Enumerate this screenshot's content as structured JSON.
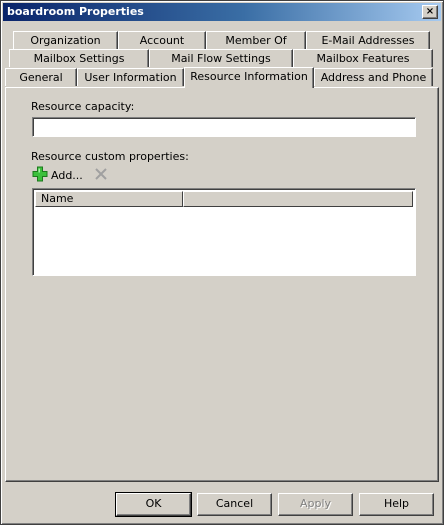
{
  "window": {
    "title": "boardroom Properties",
    "close_glyph": "×"
  },
  "tabs": {
    "row1": [
      "Organization",
      "Account",
      "Member Of",
      "E-Mail Addresses"
    ],
    "row2": [
      "Mailbox Settings",
      "Mail Flow Settings",
      "Mailbox Features"
    ],
    "row3": [
      "General",
      "User Information",
      "Resource Information",
      "Address and Phone"
    ],
    "active": "Resource Information"
  },
  "resource_tab": {
    "capacity_label": "Resource capacity:",
    "capacity_value": "",
    "custom_props_label": "Resource custom properties:",
    "add_label": "Add...",
    "list_columns": [
      "Name",
      ""
    ]
  },
  "buttons": {
    "ok": "OK",
    "cancel": "Cancel",
    "apply": "Apply",
    "help": "Help"
  },
  "icons": {
    "add": "plus-icon",
    "remove": "remove-x-icon"
  },
  "colors": {
    "titlebar_start": "#0a246a",
    "titlebar_end": "#a6caf0",
    "face": "#d4d0c8",
    "add_icon": "#3cc03c"
  }
}
